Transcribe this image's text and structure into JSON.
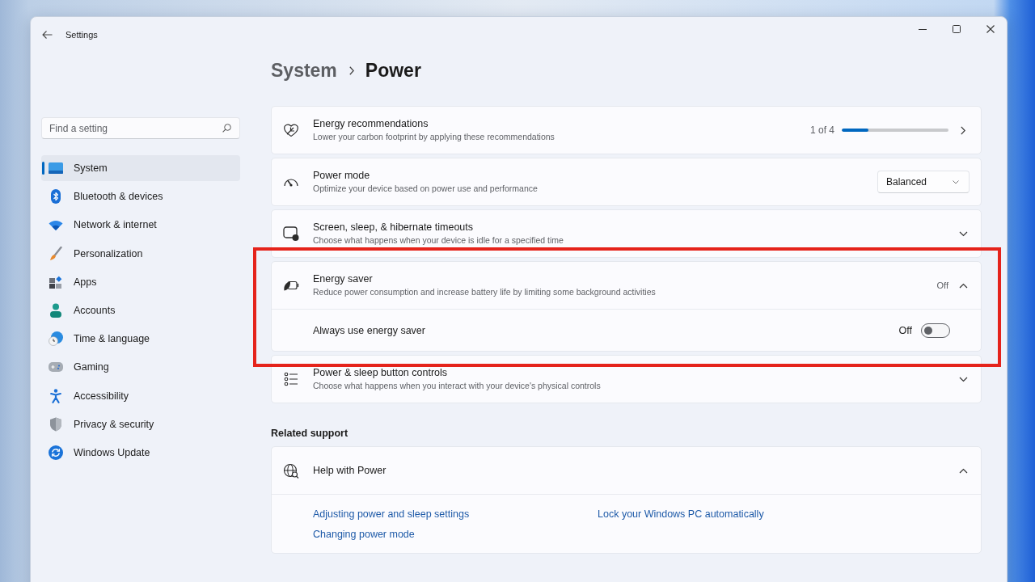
{
  "window": {
    "title": "Settings"
  },
  "search": {
    "placeholder": "Find a setting"
  },
  "sidebar": {
    "items": [
      {
        "label": "System",
        "selected": true
      },
      {
        "label": "Bluetooth & devices",
        "selected": false
      },
      {
        "label": "Network & internet",
        "selected": false
      },
      {
        "label": "Personalization",
        "selected": false
      },
      {
        "label": "Apps",
        "selected": false
      },
      {
        "label": "Accounts",
        "selected": false
      },
      {
        "label": "Time & language",
        "selected": false
      },
      {
        "label": "Gaming",
        "selected": false
      },
      {
        "label": "Accessibility",
        "selected": false
      },
      {
        "label": "Privacy & security",
        "selected": false
      },
      {
        "label": "Windows Update",
        "selected": false
      }
    ]
  },
  "breadcrumb": [
    {
      "label": "System",
      "current": false
    },
    {
      "label": "Power",
      "current": true
    }
  ],
  "cards": [
    {
      "kind": "progress",
      "title": "Energy recommendations",
      "subtitle": "Lower your carbon footprint by applying these recommendations",
      "reading": "1 of 4",
      "level": 0.25,
      "highlighted": false
    },
    {
      "kind": "dropdown",
      "title": "Power mode",
      "subtitle": "Optimize your device based on power use and performance",
      "value": "Balanced",
      "highlighted": false
    },
    {
      "kind": "expander",
      "title": "Screen, sleep, & hibernate timeouts",
      "subtitle": "Choose what happens when your device is idle for a specified time",
      "expanded": false,
      "highlighted": false
    },
    {
      "kind": "expander",
      "title": "Energy saver",
      "subtitle": "Reduce power consumption and increase battery life by limiting some background activities",
      "status": "Off",
      "expanded": true,
      "highlighted": true,
      "children": [
        {
          "kind": "toggle",
          "label": "Always use energy saver",
          "state_label": "Off",
          "on": false
        }
      ]
    },
    {
      "kind": "expander",
      "title": "Power & sleep button controls",
      "subtitle": "Choose what happens when you interact with your device's physical controls",
      "expanded": false,
      "highlighted": false
    }
  ],
  "related_support": {
    "heading": "Related support",
    "title": "Help with Power",
    "expanded": true,
    "links": [
      "Adjusting power and sleep settings",
      "Changing power mode",
      "Lock your Windows PC automatically"
    ]
  }
}
